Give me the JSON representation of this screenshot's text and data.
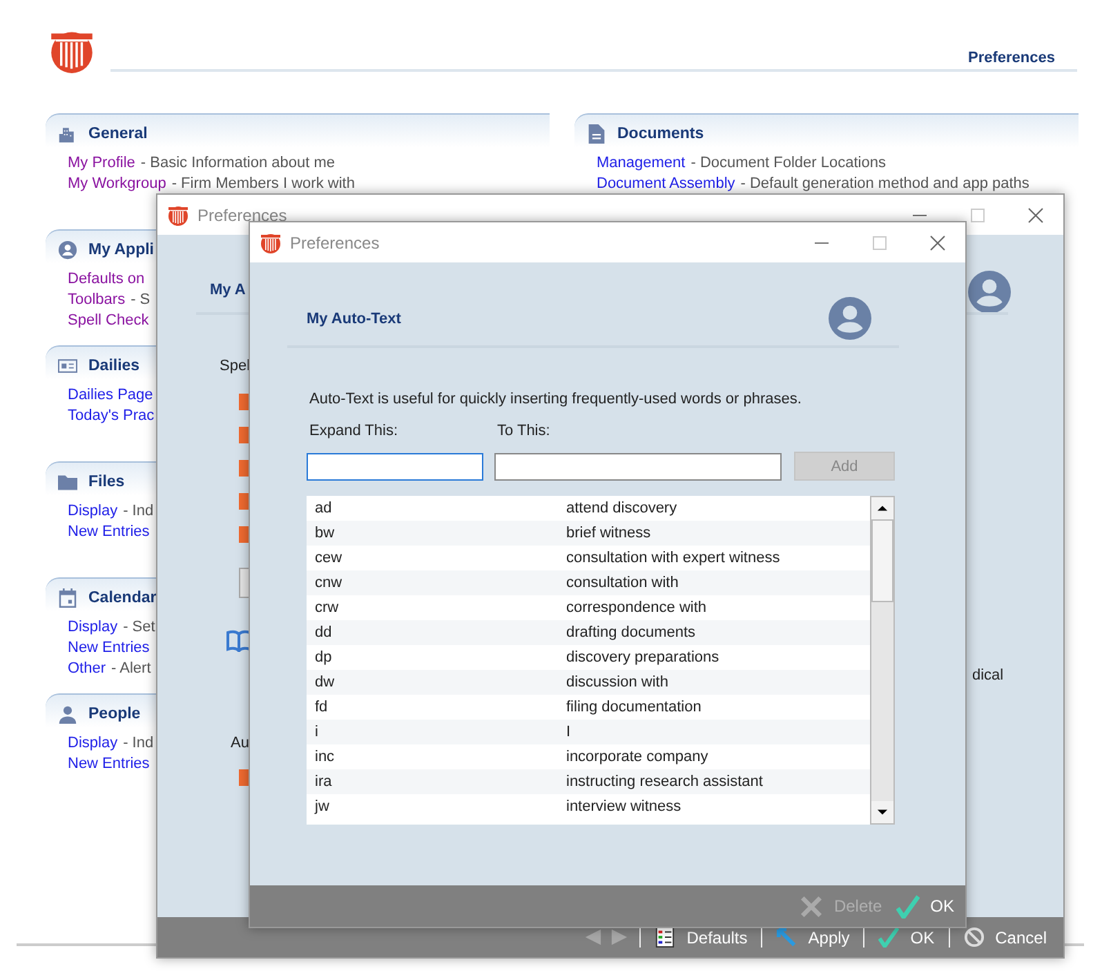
{
  "page": {
    "header_title": "Preferences",
    "left_sections": [
      {
        "kind": "general",
        "title": "General",
        "links": [
          {
            "link": "My Profile",
            "desc": "- Basic Information about me",
            "visited": true
          },
          {
            "link": "My Workgroup",
            "desc": "- Firm Members I work with",
            "visited": true
          }
        ]
      },
      {
        "kind": "application",
        "title": "My Appli",
        "links": [
          {
            "link": "Defaults on",
            "visited": true
          },
          {
            "link": "Toolbars",
            "desc": "- S",
            "visited": true
          },
          {
            "link": "Spell Check",
            "visited": true
          }
        ]
      },
      {
        "kind": "dailies",
        "title": "Dailies",
        "links": [
          {
            "link": "Dailies Page",
            "visited": false
          },
          {
            "link": "Today's Prac",
            "visited": false
          }
        ]
      },
      {
        "kind": "files",
        "title": "Files",
        "links": [
          {
            "link": "Display",
            "desc": "- Ind",
            "visited": false
          },
          {
            "link": "New Entries",
            "visited": false
          }
        ]
      },
      {
        "kind": "calendar",
        "title": "Calendar",
        "links": [
          {
            "link": "Display",
            "desc": "- Set",
            "visited": false
          },
          {
            "link": "New Entries",
            "visited": false
          },
          {
            "link": "Other",
            "desc": "- Alert",
            "visited": false
          }
        ]
      },
      {
        "kind": "people",
        "title": "People",
        "links": [
          {
            "link": "Display",
            "desc": "- Ind",
            "visited": false
          },
          {
            "link": "New Entries",
            "visited": false
          }
        ]
      }
    ],
    "right_sections": [
      {
        "kind": "documents",
        "title": "Documents",
        "links": [
          {
            "link": "Management",
            "desc": "- Document Folder Locations",
            "visited": false
          },
          {
            "link": "Document Assembly",
            "desc": "- Default generation method and app paths",
            "visited": false
          }
        ]
      }
    ]
  },
  "back_window": {
    "title": "Preferences",
    "heading": "My A",
    "label": "Spel",
    "checkboxes": [
      {
        "checked": true
      },
      {
        "checked": true
      },
      {
        "checked": true
      },
      {
        "checked": true
      },
      {
        "checked": true
      }
    ],
    "label_2": "Au",
    "checkbox_2": {
      "checked": true
    },
    "side_text": "dical",
    "footer": [
      {
        "kind": "prev",
        "disabled": true
      },
      {
        "kind": "next",
        "disabled": true
      },
      {
        "kind": "defaults",
        "label": "Defaults"
      },
      {
        "kind": "apply",
        "label": "Apply"
      },
      {
        "kind": "ok",
        "label": "OK"
      },
      {
        "kind": "cancel",
        "label": "Cancel"
      }
    ]
  },
  "front_window": {
    "title": "Preferences",
    "heading": "My Auto-Text",
    "description": "Auto-Text is useful for quickly inserting frequently-used words or phrases.",
    "expand_label": "Expand This:",
    "to_label": "To This:",
    "add_button": {
      "label": "Add",
      "disabled": true
    },
    "rows": [
      {
        "short": "ad",
        "text": "attend discovery"
      },
      {
        "short": "bw",
        "text": "brief witness"
      },
      {
        "short": "cew",
        "text": "consultation with expert witness"
      },
      {
        "short": "cnw",
        "text": "consultation with"
      },
      {
        "short": "crw",
        "text": "correspondence with"
      },
      {
        "short": "dd",
        "text": "drafting documents"
      },
      {
        "short": "dp",
        "text": "discovery preparations"
      },
      {
        "short": "dw",
        "text": "discussion with"
      },
      {
        "short": "fd",
        "text": "filing documentation"
      },
      {
        "short": "i",
        "text": "I"
      },
      {
        "short": "inc",
        "text": "incorporate company"
      },
      {
        "short": "ira",
        "text": "instructing research assistant"
      },
      {
        "short": "jw",
        "text": "interview witness"
      }
    ],
    "footer": [
      {
        "kind": "delete",
        "label": "Delete",
        "disabled": true
      },
      {
        "kind": "ok",
        "label": "OK",
        "disabled": false
      }
    ]
  }
}
